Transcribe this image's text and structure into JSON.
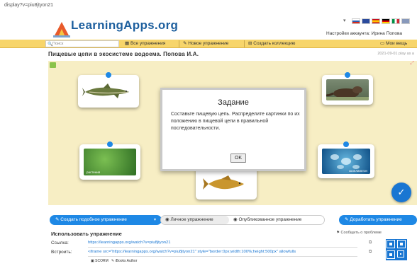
{
  "browser": {
    "url": "display?v=piu8jtyon21"
  },
  "header": {
    "logo_text": "LearningApps.org",
    "account_label": "Настройки аккаунта: Ирина Попова",
    "colors": {
      "brand": "#1d5f9e",
      "nav_bg": "#f7d56b"
    }
  },
  "nav": {
    "search_placeholder": "Поиск",
    "all_exercises": "Все упражнения",
    "new_exercise": "Новое упражнение",
    "create_collection": "Создать коллекцию",
    "my_apps": "Мои вещь"
  },
  "exercise": {
    "title": "Пищевые цепи в экосистеме водоема. Попова И.А.",
    "date": "2021-09-01 play as a"
  },
  "cards": {
    "plant_caption": "растения",
    "plankton_caption": "зоопланктон"
  },
  "dialog": {
    "title": "Задание",
    "text": "Составьте пищевую цепь. Распределите картинки по их положению в пищевой цепи в правильной последовательности.",
    "ok": "OK"
  },
  "actions": {
    "create_similar": "Создать подобное упражнение",
    "private": "Личное упражнение",
    "published": "Опубликованное упражнение",
    "improve": "Доработать упражнение"
  },
  "embed": {
    "title": "Использовать упражнение",
    "report": "Сообщить о проблеме",
    "link_label": "Ссылка:",
    "link_value": "https://learningapps.org/watch?v=piu8jtyon21",
    "embed_label": "Встроить:",
    "embed_value": "<iframe src=\"https://learningapps.org/watch?v=piu8jtyon21\" style=\"border:0px;width:100%;height:500px\" allowfulls",
    "scorm": "SCORM",
    "ibooks": "iBooks Author"
  }
}
